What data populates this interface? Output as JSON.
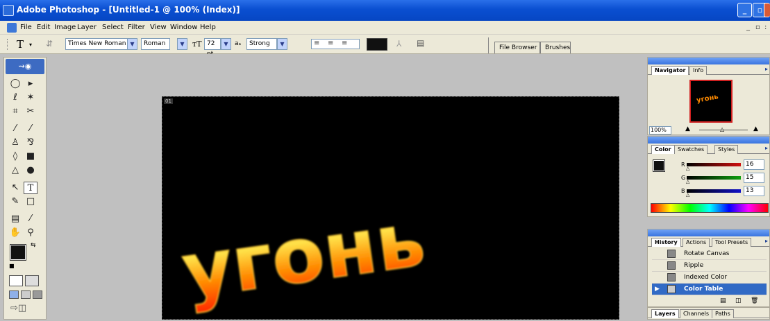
{
  "window": {
    "title": "Adobe Photoshop - [Untitled-1 @ 100% (Index)]"
  },
  "menu": [
    "File",
    "Edit",
    "Image",
    "Layer",
    "Select",
    "Filter",
    "View",
    "Window",
    "Help"
  ],
  "options": {
    "tool_glyph": "T",
    "font_family": "Times New Roman ...",
    "font_style": "Roman",
    "font_size": "72 pt",
    "aa_label": "aₐ",
    "anti_alias": "Strong"
  },
  "palette_well": {
    "tabs": [
      "File Browser",
      "Brushes"
    ]
  },
  "document": {
    "label": "01",
    "text": "угонь"
  },
  "navigator": {
    "tabs": [
      "Navigator",
      "Info"
    ],
    "zoom": "100%"
  },
  "color": {
    "tabs": [
      "Color",
      "Swatches",
      "Styles"
    ],
    "channels": [
      {
        "name": "R",
        "value": "16",
        "color": "#d01010"
      },
      {
        "name": "G",
        "value": "15",
        "color": "#10a010"
      },
      {
        "name": "B",
        "value": "13",
        "color": "#1010c8"
      }
    ]
  },
  "history": {
    "tabs": [
      "History",
      "Actions",
      "Tool Presets"
    ],
    "items": [
      {
        "label": "Rotate Canvas",
        "selected": false
      },
      {
        "label": "Ripple",
        "selected": false
      },
      {
        "label": "Indexed Color",
        "selected": false
      },
      {
        "label": "Color Table",
        "selected": true
      }
    ]
  },
  "layers": {
    "tabs": [
      "Layers",
      "Channels",
      "Paths"
    ]
  },
  "colors": {
    "titlebar": "#0a4fd1",
    "selection": "#316ac5",
    "chrome": "#ece9d8"
  }
}
